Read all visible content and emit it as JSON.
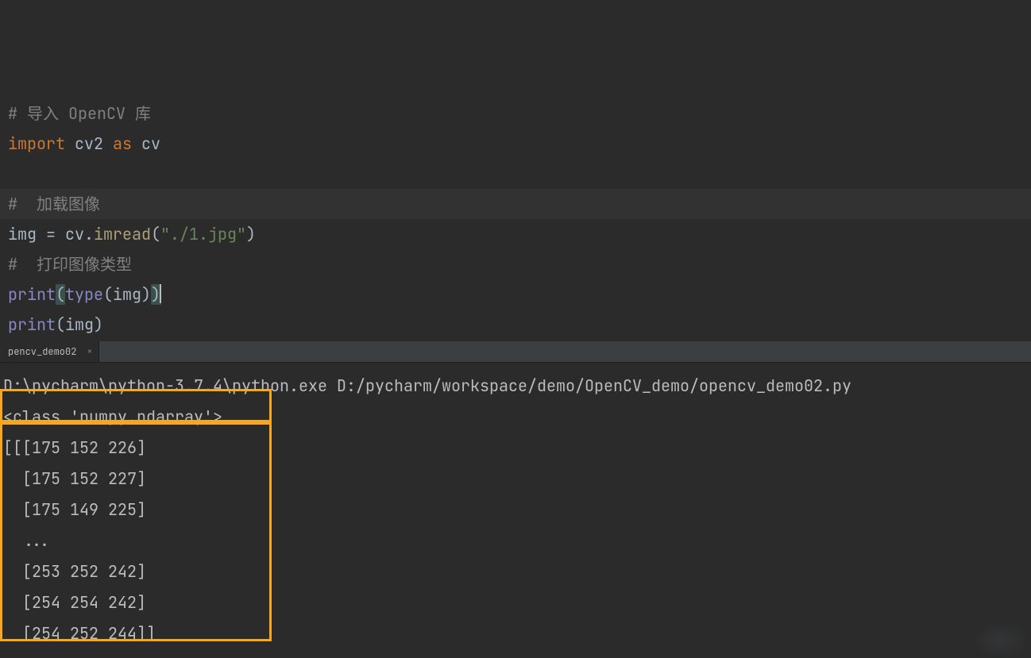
{
  "editor": {
    "lines": [
      {
        "type": "comment",
        "text": "# 导入 OpenCV 库"
      },
      {
        "type": "import",
        "kw1": "import",
        "mod": "cv2",
        "kw2": "as",
        "alias": "cv"
      },
      {
        "type": "blank",
        "text": ""
      },
      {
        "type": "comment",
        "text": "#  加载图像"
      },
      {
        "type": "assign",
        "lhs": "img",
        "op": " = ",
        "obj": "cv",
        "dot": ".",
        "fn": "imread",
        "lpar": "(",
        "str": "\"./1.jpg\"",
        "rpar": ")"
      },
      {
        "type": "comment",
        "text": "#  打印图像类型"
      },
      {
        "type": "call2",
        "fn": "print",
        "lpar": "(",
        "inner": "type",
        "ilpar": "(",
        "arg": "img",
        "irpar": ")",
        "rpar": ")",
        "current": true
      },
      {
        "type": "call1",
        "fn": "print",
        "lpar": "(",
        "arg": "img",
        "rpar": ")"
      }
    ]
  },
  "run_tab": {
    "label": "pencv_demo02"
  },
  "console": {
    "cmd": "D:\\pycharm\\python-3.7.4\\python.exe D:/pycharm/workspace/demo/OpenCV_demo/opencv_demo02.py",
    "type_line": "<class 'numpy.ndarray'>",
    "array_lines": [
      "[[[175 152 226]",
      "  [175 152 227]",
      "  [175 149 225]",
      "  ...",
      "  [253 252 242]",
      "  [254 254 242]",
      "  [254 252 244]]"
    ]
  }
}
